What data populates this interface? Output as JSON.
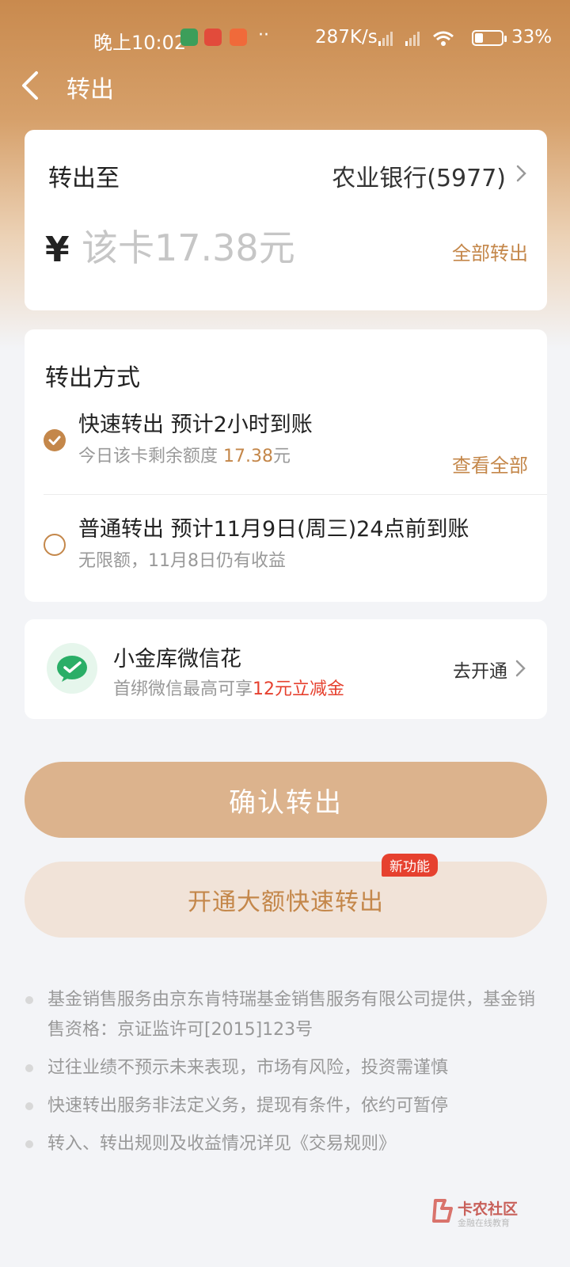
{
  "status_bar": {
    "time": "晚上10:02",
    "dots": "··",
    "network_speed": "287K/s",
    "battery": "33%"
  },
  "header": {
    "title": "转出"
  },
  "destination": {
    "label": "转出至",
    "bank": "农业银行(5977)"
  },
  "amount": {
    "currency": "¥",
    "placeholder": "该卡17.38元",
    "all_out_label": "全部转出"
  },
  "methods": {
    "title": "转出方式",
    "fast": {
      "label": "快速转出 预计2小时到账",
      "quota_prefix": "今日该卡剩余额度 ",
      "quota_value": "17.38",
      "quota_unit": "元",
      "view_all": "查看全部",
      "checked": true
    },
    "normal": {
      "label": "普通转出 预计11月9日(周三)24点前到账",
      "sub": "无限额，11月8日仍有收益",
      "checked": false
    }
  },
  "wechat_card": {
    "title": "小金库微信花",
    "sub_prefix": "首绑微信最高可享",
    "sub_highlight": "12元立减金",
    "action": "去开通"
  },
  "buttons": {
    "confirm": "确认转出",
    "large_fast": "开通大额快速转出",
    "new_badge": "新功能"
  },
  "notes": [
    "基金销售服务由京东肯特瑞基金销售服务有限公司提供，基金销售资格：京证监许可[2015]123号",
    "过往业绩不预示未来表现，市场有风险，投资需谨慎",
    "快速转出服务非法定义务，提现有条件，依约可暂停",
    "转入、转出规则及收益情况详见《交易规则》"
  ],
  "watermark": {
    "title": "卡农社区",
    "sub": "金融在线教育"
  },
  "colors": {
    "accent": "#c4874a",
    "header_top": "#c98a4e",
    "confirm_btn": "#dcb38d",
    "highlight_red": "#e6412f",
    "wechat_green": "#2aae67"
  }
}
